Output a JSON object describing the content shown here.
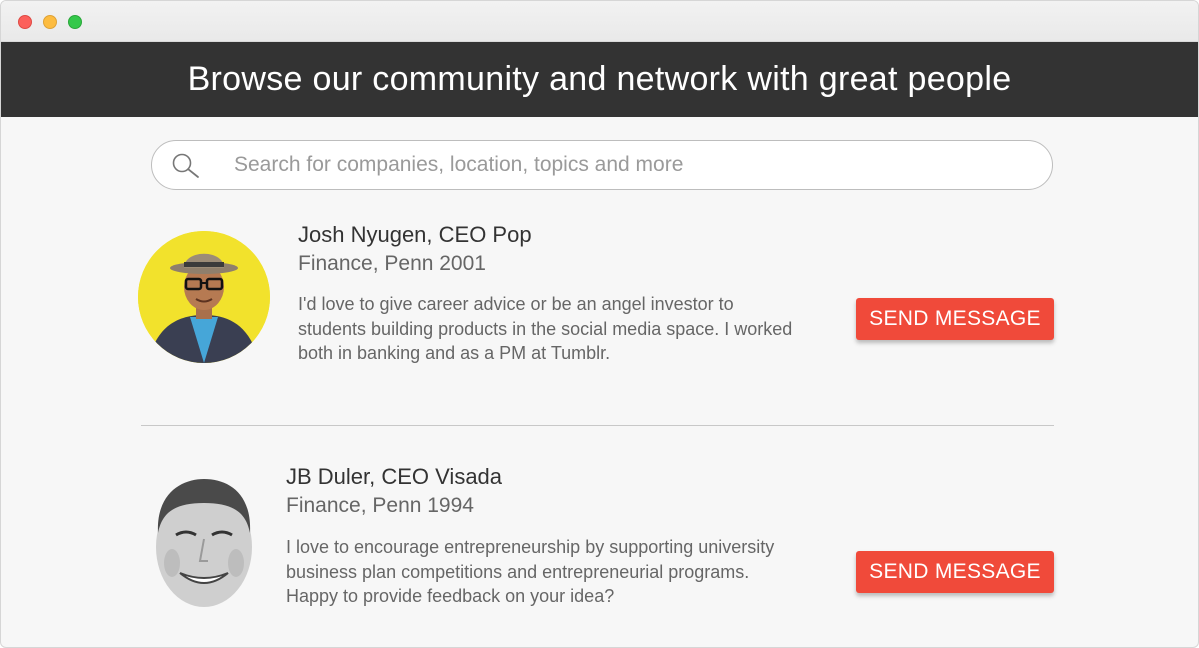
{
  "window": {
    "controls": [
      "close",
      "minimize",
      "maximize"
    ]
  },
  "banner": {
    "title": "Browse our community and network with great people"
  },
  "search": {
    "icon": "search-icon",
    "placeholder": "Search for companies, location, topics and more"
  },
  "people": [
    {
      "name": "Josh Nyugen, CEO Pop",
      "subtitle": "Finance, Penn 2001",
      "bio": "I'd love to give career advice or be an angel investor to students building products in the social media space. I worked both in banking and as a PM at Tumblr.",
      "button_label": "SEND MESSAGE"
    },
    {
      "name": "JB Duler, CEO Visada",
      "subtitle": "Finance, Penn 1994",
      "bio": "I love to encourage entrepreneurship by supporting university business plan competitions and entrepreneurial programs. Happy to provide feedback on your idea?",
      "button_label": "SEND MESSAGE"
    }
  ],
  "colors": {
    "banner_bg": "#333333",
    "accent": "#f04a3a",
    "page_bg": "#f7f7f7"
  }
}
